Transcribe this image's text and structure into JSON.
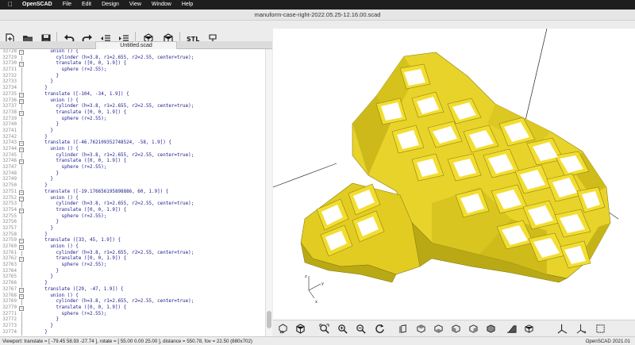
{
  "menubar": {
    "items": [
      "OpenSCAD",
      "File",
      "Edit",
      "Design",
      "View",
      "Window",
      "Help"
    ]
  },
  "window": {
    "title": "manuform-case-right-2022.05.25-12.16.00.scad"
  },
  "editor": {
    "tab_title": "Untitled.scad",
    "toolbar_icons": [
      "new-file-icon",
      "open-file-icon",
      "save-icon",
      "undo-icon",
      "redo-icon",
      "unindent-icon",
      "indent-icon",
      "preview-icon",
      "render-icon",
      "export-stl-icon",
      "send-to-print-icon"
    ],
    "stl_label": "STL",
    "lines": [
      {
        "n": "32728",
        "fold": "minus",
        "text": "        union () {"
      },
      {
        "n": "32729",
        "fold": "",
        "text": "          cylinder (h=3.8, r1=2.655, r2=2.55, center=true);"
      },
      {
        "n": "32730",
        "fold": "minus",
        "text": "          translate ([0, 0, 1.9]) {"
      },
      {
        "n": "32731",
        "fold": "",
        "text": "            sphere (r=2.55);"
      },
      {
        "n": "32732",
        "fold": "",
        "text": "          }"
      },
      {
        "n": "32733",
        "fold": "",
        "text": "        }"
      },
      {
        "n": "32734",
        "fold": "",
        "text": "      }"
      },
      {
        "n": "32735",
        "fold": "minus",
        "text": "      translate ([-104, -34, 1.9]) {"
      },
      {
        "n": "32736",
        "fold": "minus",
        "text": "        union () {"
      },
      {
        "n": "32737",
        "fold": "",
        "text": "          cylinder (h=3.8, r1=2.655, r2=2.55, center=true);"
      },
      {
        "n": "32738",
        "fold": "minus",
        "text": "          translate ([0, 0, 1.9]) {"
      },
      {
        "n": "32739",
        "fold": "",
        "text": "            sphere (r=2.55);"
      },
      {
        "n": "32740",
        "fold": "",
        "text": "          }"
      },
      {
        "n": "32741",
        "fold": "",
        "text": "        }"
      },
      {
        "n": "32742",
        "fold": "",
        "text": "      }"
      },
      {
        "n": "32743",
        "fold": "minus",
        "text": "      translate ([-46.762109352748524, -58, 1.9]) {"
      },
      {
        "n": "32744",
        "fold": "minus",
        "text": "        union () {"
      },
      {
        "n": "32745",
        "fold": "",
        "text": "          cylinder (h=3.8, r1=2.655, r2=2.55, center=true);"
      },
      {
        "n": "32746",
        "fold": "minus",
        "text": "          translate ([0, 0, 1.9]) {"
      },
      {
        "n": "32747",
        "fold": "",
        "text": "            sphere (r=2.55);"
      },
      {
        "n": "32748",
        "fold": "",
        "text": "          }"
      },
      {
        "n": "32749",
        "fold": "",
        "text": "        }"
      },
      {
        "n": "32750",
        "fold": "",
        "text": "      }"
      },
      {
        "n": "32751",
        "fold": "minus",
        "text": "      translate ([-19.176656195898886, 60, 1.9]) {"
      },
      {
        "n": "32752",
        "fold": "minus",
        "text": "        union () {"
      },
      {
        "n": "32753",
        "fold": "",
        "text": "          cylinder (h=3.8, r1=2.655, r2=2.55, center=true);"
      },
      {
        "n": "32754",
        "fold": "minus",
        "text": "          translate ([0, 0, 1.9]) {"
      },
      {
        "n": "32755",
        "fold": "",
        "text": "            sphere (r=2.55);"
      },
      {
        "n": "32756",
        "fold": "",
        "text": "          }"
      },
      {
        "n": "32757",
        "fold": "",
        "text": "        }"
      },
      {
        "n": "32758",
        "fold": "",
        "text": "      }"
      },
      {
        "n": "32759",
        "fold": "minus",
        "text": "      translate ([33, 45, 1.9]) {"
      },
      {
        "n": "32760",
        "fold": "minus",
        "text": "        union () {"
      },
      {
        "n": "32761",
        "fold": "",
        "text": "          cylinder (h=3.8, r1=2.655, r2=2.55, center=true);"
      },
      {
        "n": "32762",
        "fold": "minus",
        "text": "          translate ([0, 0, 1.9]) {"
      },
      {
        "n": "32763",
        "fold": "",
        "text": "            sphere (r=2.55);"
      },
      {
        "n": "32764",
        "fold": "",
        "text": "          }"
      },
      {
        "n": "32765",
        "fold": "",
        "text": "        }"
      },
      {
        "n": "32766",
        "fold": "",
        "text": "      }"
      },
      {
        "n": "32767",
        "fold": "minus",
        "text": "      translate ([29, -47, 1.9]) {"
      },
      {
        "n": "32768",
        "fold": "minus",
        "text": "        union () {"
      },
      {
        "n": "32769",
        "fold": "",
        "text": "          cylinder (h=3.8, r1=2.655, r2=2.55, center=true);"
      },
      {
        "n": "32770",
        "fold": "minus",
        "text": "          translate ([0, 0, 1.9]) {"
      },
      {
        "n": "32771",
        "fold": "",
        "text": "            sphere (r=2.55);"
      },
      {
        "n": "32772",
        "fold": "",
        "text": "          }"
      },
      {
        "n": "32773",
        "fold": "",
        "text": "        }"
      },
      {
        "n": "32774",
        "fold": "",
        "text": "      }"
      }
    ]
  },
  "viewer": {
    "model_color": "#e8d32a",
    "model_shadow": "#a89a10",
    "axis_labels": [
      "x",
      "y",
      "z"
    ],
    "toolbar_icons": [
      "preview-mode-icon",
      "render-mode-icon",
      "zoom-all-icon",
      "zoom-in-icon",
      "zoom-out-icon",
      "reset-view-icon",
      "view-right-icon",
      "view-top-icon",
      "view-bottom-icon",
      "view-left-icon",
      "view-front-icon",
      "view-back-icon",
      "view-diagonal-icon",
      "view-center-icon",
      "perspective-icon",
      "orthogonal-icon",
      "show-axes-icon",
      "show-scale-icon",
      "show-edges-icon"
    ]
  },
  "status": {
    "viewport": "Viewport: translate = [ -79.45 58.93 -27.74 ], rotate = [ 55.00 0.00 25.00 ], distance = 550.78, fov = 22.50 (880x702)",
    "version": "OpenSCAD 2021.01"
  }
}
